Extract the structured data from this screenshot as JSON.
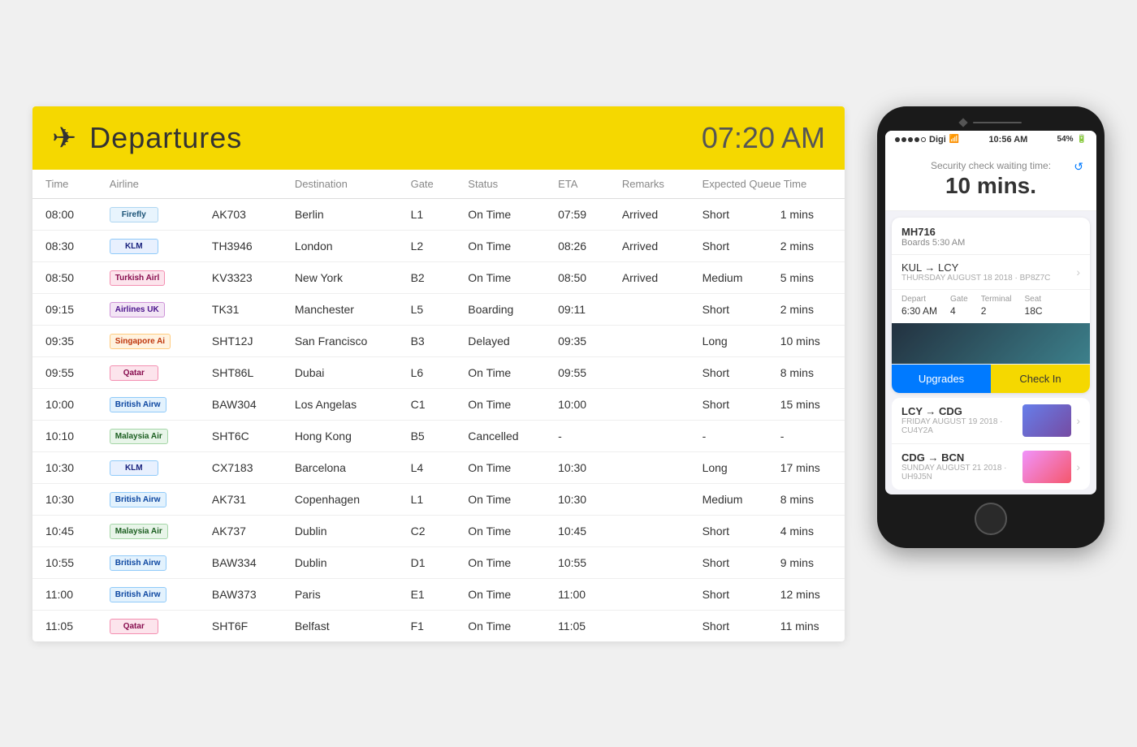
{
  "header": {
    "title": "Departures",
    "time": "07:20 AM",
    "plane_icon": "✈"
  },
  "table": {
    "columns": [
      "Time",
      "Airline",
      "",
      "Destination",
      "Gate",
      "Status",
      "ETA",
      "Remarks",
      "Expected Queue Time",
      ""
    ],
    "rows": [
      {
        "time": "08:00",
        "airline_code": "Firefly",
        "flight": "AK703",
        "destination": "Berlin",
        "gate": "L1",
        "status": "On Time",
        "eta": "07:59",
        "remarks": "Arrived",
        "queue": "Short",
        "mins": "1 mins",
        "queue_class": "queue-short",
        "mins_class": "mins-short",
        "status_class": "status-ontime",
        "logo_class": "logo-firefly"
      },
      {
        "time": "08:30",
        "airline_code": "KLM",
        "flight": "TH3946",
        "destination": "London",
        "gate": "L2",
        "status": "On Time",
        "eta": "08:26",
        "remarks": "Arrived",
        "queue": "Short",
        "mins": "2 mins",
        "queue_class": "queue-short",
        "mins_class": "mins-short",
        "status_class": "status-ontime",
        "logo_class": "logo-klm"
      },
      {
        "time": "08:50",
        "airline_code": "Turkish Airlines",
        "flight": "KV3323",
        "destination": "New York",
        "gate": "B2",
        "status": "On Time",
        "eta": "08:50",
        "remarks": "Arrived",
        "queue": "Medium",
        "mins": "5 mins",
        "queue_class": "queue-medium",
        "mins_class": "mins-medium",
        "status_class": "status-ontime",
        "logo_class": "logo-turkish"
      },
      {
        "time": "09:15",
        "airline_code": "Airlines UK",
        "flight": "TK31",
        "destination": "Manchester",
        "gate": "L5",
        "status": "Boarding",
        "eta": "09:11",
        "remarks": "",
        "queue": "Short",
        "mins": "2 mins",
        "queue_class": "queue-short",
        "mins_class": "mins-short",
        "status_class": "status-boarding",
        "logo_class": "logo-airlines-uk"
      },
      {
        "time": "09:35",
        "airline_code": "Singapore Airlines",
        "flight": "SHT12J",
        "destination": "San Francisco",
        "gate": "B3",
        "status": "Delayed",
        "eta": "09:35",
        "remarks": "",
        "queue": "Long",
        "mins": "10 mins",
        "queue_class": "queue-long",
        "mins_class": "mins-long",
        "status_class": "status-delayed",
        "logo_class": "logo-singapore"
      },
      {
        "time": "09:55",
        "airline_code": "Qatar",
        "flight": "SHT86L",
        "destination": "Dubai",
        "gate": "L6",
        "status": "On Time",
        "eta": "09:55",
        "remarks": "",
        "queue": "Short",
        "mins": "8 mins",
        "queue_class": "queue-short",
        "mins_class": "mins-short",
        "status_class": "status-ontime",
        "logo_class": "logo-qatar"
      },
      {
        "time": "10:00",
        "airline_code": "British Airways",
        "flight": "BAW304",
        "destination": "Los Angelas",
        "gate": "C1",
        "status": "On Time",
        "eta": "10:00",
        "remarks": "",
        "queue": "Short",
        "mins": "15 mins",
        "queue_class": "queue-short",
        "mins_class": "mins-short",
        "status_class": "status-ontime",
        "logo_class": "logo-british"
      },
      {
        "time": "10:10",
        "airline_code": "Malaysia Airlines",
        "flight": "SHT6C",
        "destination": "Hong Kong",
        "gate": "B5",
        "status": "Cancelled",
        "eta": "-",
        "remarks": "",
        "queue": "-",
        "mins": "-",
        "queue_class": "",
        "mins_class": "",
        "status_class": "status-cancelled",
        "logo_class": "logo-malaysia"
      },
      {
        "time": "10:30",
        "airline_code": "KLM",
        "flight": "CX7183",
        "destination": "Barcelona",
        "gate": "L4",
        "status": "On Time",
        "eta": "10:30",
        "remarks": "",
        "queue": "Long",
        "mins": "17 mins",
        "queue_class": "queue-long",
        "mins_class": "mins-long",
        "status_class": "status-ontime",
        "logo_class": "logo-klm"
      },
      {
        "time": "10:30",
        "airline_code": "British Airways",
        "flight": "AK731",
        "destination": "Copenhagen",
        "gate": "L1",
        "status": "On Time",
        "eta": "10:30",
        "remarks": "",
        "queue": "Medium",
        "mins": "8 mins",
        "queue_class": "queue-medium",
        "mins_class": "mins-medium",
        "status_class": "status-ontime",
        "logo_class": "logo-british"
      },
      {
        "time": "10:45",
        "airline_code": "Malaysia Airlines",
        "flight": "AK737",
        "destination": "Dublin",
        "gate": "C2",
        "status": "On Time",
        "eta": "10:45",
        "remarks": "",
        "queue": "Short",
        "mins": "4 mins",
        "queue_class": "queue-short",
        "mins_class": "mins-short",
        "status_class": "status-ontime",
        "logo_class": "logo-malaysia"
      },
      {
        "time": "10:55",
        "airline_code": "British Airways",
        "flight": "BAW334",
        "destination": "Dublin",
        "gate": "D1",
        "status": "On Time",
        "eta": "10:55",
        "remarks": "",
        "queue": "Short",
        "mins": "9 mins",
        "queue_class": "queue-short",
        "mins_class": "mins-short",
        "status_class": "status-ontime",
        "logo_class": "logo-british"
      },
      {
        "time": "11:00",
        "airline_code": "British Airways",
        "flight": "BAW373",
        "destination": "Paris",
        "gate": "E1",
        "status": "On Time",
        "eta": "11:00",
        "remarks": "",
        "queue": "Short",
        "mins": "12 mins",
        "queue_class": "queue-short",
        "mins_class": "mins-short",
        "status_class": "status-ontime",
        "logo_class": "logo-british"
      },
      {
        "time": "11:05",
        "airline_code": "Qatar",
        "flight": "SHT6F",
        "destination": "Belfast",
        "gate": "F1",
        "status": "On Time",
        "eta": "11:05",
        "remarks": "",
        "queue": "Short",
        "mins": "11 mins",
        "queue_class": "queue-short",
        "mins_class": "mins-short",
        "status_class": "status-ontime",
        "logo_class": "logo-qatar"
      }
    ]
  },
  "phone": {
    "status_bar": {
      "carrier": "Digi",
      "time": "10:56 AM",
      "battery": "54%"
    },
    "security": {
      "label": "Security check waiting time:",
      "time": "10 mins.",
      "reload_icon": "↺"
    },
    "main_flight": {
      "number": "MH716",
      "boards": "Boards 5:30 AM",
      "route": "KUL → LCY",
      "date": "THURSDAY AUGUST 18 2018 · BP8Z7C",
      "depart_label": "Depart",
      "depart_value": "6:30 AM",
      "gate_label": "Gate",
      "gate_value": "4",
      "terminal_label": "Terminal",
      "terminal_value": "2",
      "seat_label": "Seat",
      "seat_value": "18C",
      "upgrades_btn": "Upgrades",
      "checkin_btn": "Check In"
    },
    "next_flights": [
      {
        "route": "LCY → CDG",
        "date": "FRIDAY AUGUST 19 2018 · CU4Y2A"
      },
      {
        "route": "CDG → BCN",
        "date": "SUNDAY AUGUST 21 2018 · UH9J5N"
      }
    ]
  }
}
